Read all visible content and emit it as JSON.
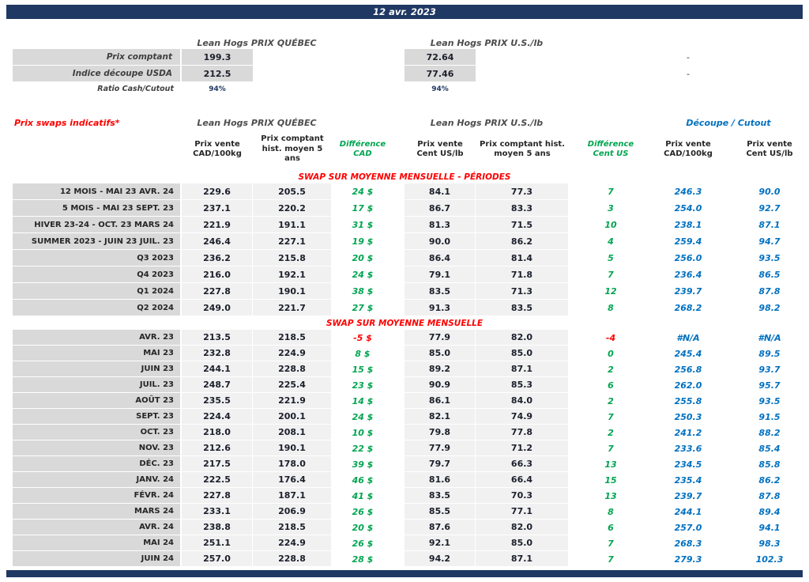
{
  "colors": {
    "navy": "#1F3864",
    "red": "#FF0000",
    "green": "#00A550",
    "blue": "#0070C0",
    "label_gray": "#D9D9D9",
    "cell_gray": "#F1F1F2"
  },
  "date_bar": {
    "date": "12 avr. 2023"
  },
  "spot": {
    "qc_title": "Lean Hogs PRIX QUÉBEC",
    "us_title": "Lean Hogs PRIX U.S./lb",
    "rows": [
      {
        "label": "Prix comptant",
        "qc": "199.3",
        "us": "72.64",
        "cutout": "-"
      },
      {
        "label": "Indice découpe USDA",
        "qc": "212.5",
        "us": "77.46",
        "cutout": "-"
      },
      {
        "label": "Ratio Cash/Cutout",
        "qc": "94%",
        "us": "94%",
        "cutout": ""
      }
    ]
  },
  "swaps": {
    "title": "Prix swaps indicatifs*",
    "qc_title": "Lean Hogs PRIX QUÉBEC",
    "us_title": "Lean Hogs PRIX U.S./lb",
    "cutout_title": "Découpe / Cutout",
    "columns": {
      "qc_sell": "Prix vente CAD/100kg",
      "qc_hist": "Prix comptant hist. moyen 5 ans",
      "diff_cad": "Différence CAD",
      "us_sell": "Prix vente Cent US/lb",
      "us_hist": "Prix comptant hist. moyen 5 ans",
      "diff_us": "Différence Cent US",
      "cut_cad": "Prix vente CAD/100kg",
      "cut_us": "Prix vente Cent US/lb"
    },
    "sections": [
      {
        "title": "SWAP SUR MOYENNE MENSUELLE - PÉRIODES",
        "rows": [
          {
            "label": "12 MOIS - MAI 23 AVR. 24",
            "qc_sell": "229.6",
            "qc_hist": "205.5",
            "diff_cad": "24 $",
            "us_sell": "84.1",
            "us_hist": "77.3",
            "diff_us": "7",
            "cut_cad": "246.3",
            "cut_us": "90.0"
          },
          {
            "label": "5 MOIS - MAI 23 SEPT. 23",
            "qc_sell": "237.1",
            "qc_hist": "220.2",
            "diff_cad": "17 $",
            "us_sell": "86.7",
            "us_hist": "83.3",
            "diff_us": "3",
            "cut_cad": "254.0",
            "cut_us": "92.7"
          },
          {
            "label": "HIVER 23-24 -  OCT. 23 MARS 24",
            "qc_sell": "221.9",
            "qc_hist": "191.1",
            "diff_cad": "31 $",
            "us_sell": "81.3",
            "us_hist": "71.5",
            "diff_us": "10",
            "cut_cad": "238.1",
            "cut_us": "87.1"
          },
          {
            "label": "SUMMER 2023 - JUIN 23 JUIL. 23",
            "qc_sell": "246.4",
            "qc_hist": "227.1",
            "diff_cad": "19 $",
            "us_sell": "90.0",
            "us_hist": "86.2",
            "diff_us": "4",
            "cut_cad": "259.4",
            "cut_us": "94.7"
          },
          {
            "label": "Q3 2023",
            "qc_sell": "236.2",
            "qc_hist": "215.8",
            "diff_cad": "20 $",
            "us_sell": "86.4",
            "us_hist": "81.4",
            "diff_us": "5",
            "cut_cad": "256.0",
            "cut_us": "93.5"
          },
          {
            "label": "Q4 2023",
            "qc_sell": "216.0",
            "qc_hist": "192.1",
            "diff_cad": "24 $",
            "us_sell": "79.1",
            "us_hist": "71.8",
            "diff_us": "7",
            "cut_cad": "236.4",
            "cut_us": "86.5"
          },
          {
            "label": "Q1 2024",
            "qc_sell": "227.8",
            "qc_hist": "190.1",
            "diff_cad": "38 $",
            "us_sell": "83.5",
            "us_hist": "71.3",
            "diff_us": "12",
            "cut_cad": "239.7",
            "cut_us": "87.8"
          },
          {
            "label": "Q2 2024",
            "qc_sell": "249.0",
            "qc_hist": "221.7",
            "diff_cad": "27 $",
            "us_sell": "91.3",
            "us_hist": "83.5",
            "diff_us": "8",
            "cut_cad": "268.2",
            "cut_us": "98.2"
          }
        ]
      },
      {
        "title": "SWAP SUR MOYENNE MENSUELLE",
        "rows": [
          {
            "label": "AVR. 23",
            "qc_sell": "213.5",
            "qc_hist": "218.5",
            "diff_cad": "-5 $",
            "us_sell": "77.9",
            "us_hist": "82.0",
            "diff_us": "-4",
            "cut_cad": "#N/A",
            "cut_us": "#N/A"
          },
          {
            "label": "MAI 23",
            "qc_sell": "232.8",
            "qc_hist": "224.9",
            "diff_cad": "8 $",
            "us_sell": "85.0",
            "us_hist": "85.0",
            "diff_us": "0",
            "cut_cad": "245.4",
            "cut_us": "89.5"
          },
          {
            "label": "JUIN 23",
            "qc_sell": "244.1",
            "qc_hist": "228.8",
            "diff_cad": "15 $",
            "us_sell": "89.2",
            "us_hist": "87.1",
            "diff_us": "2",
            "cut_cad": "256.8",
            "cut_us": "93.7"
          },
          {
            "label": "JUIL. 23",
            "qc_sell": "248.7",
            "qc_hist": "225.4",
            "diff_cad": "23 $",
            "us_sell": "90.9",
            "us_hist": "85.3",
            "diff_us": "6",
            "cut_cad": "262.0",
            "cut_us": "95.7"
          },
          {
            "label": "AOÛT 23",
            "qc_sell": "235.5",
            "qc_hist": "221.9",
            "diff_cad": "14 $",
            "us_sell": "86.1",
            "us_hist": "84.0",
            "diff_us": "2",
            "cut_cad": "255.8",
            "cut_us": "93.5"
          },
          {
            "label": "SEPT. 23",
            "qc_sell": "224.4",
            "qc_hist": "200.1",
            "diff_cad": "24 $",
            "us_sell": "82.1",
            "us_hist": "74.9",
            "diff_us": "7",
            "cut_cad": "250.3",
            "cut_us": "91.5"
          },
          {
            "label": "OCT. 23",
            "qc_sell": "218.0",
            "qc_hist": "208.1",
            "diff_cad": "10 $",
            "us_sell": "79.8",
            "us_hist": "77.8",
            "diff_us": "2",
            "cut_cad": "241.2",
            "cut_us": "88.2"
          },
          {
            "label": "NOV. 23",
            "qc_sell": "212.6",
            "qc_hist": "190.1",
            "diff_cad": "22 $",
            "us_sell": "77.9",
            "us_hist": "71.2",
            "diff_us": "7",
            "cut_cad": "233.6",
            "cut_us": "85.4"
          },
          {
            "label": "DÉC. 23",
            "qc_sell": "217.5",
            "qc_hist": "178.0",
            "diff_cad": "39 $",
            "us_sell": "79.7",
            "us_hist": "66.3",
            "diff_us": "13",
            "cut_cad": "234.5",
            "cut_us": "85.8"
          },
          {
            "label": "JANV. 24",
            "qc_sell": "222.5",
            "qc_hist": "176.4",
            "diff_cad": "46 $",
            "us_sell": "81.6",
            "us_hist": "66.4",
            "diff_us": "15",
            "cut_cad": "235.4",
            "cut_us": "86.2"
          },
          {
            "label": "FÉVR. 24",
            "qc_sell": "227.8",
            "qc_hist": "187.1",
            "diff_cad": "41 $",
            "us_sell": "83.5",
            "us_hist": "70.3",
            "diff_us": "13",
            "cut_cad": "239.7",
            "cut_us": "87.8"
          },
          {
            "label": "MARS 24",
            "qc_sell": "233.1",
            "qc_hist": "206.9",
            "diff_cad": "26 $",
            "us_sell": "85.5",
            "us_hist": "77.1",
            "diff_us": "8",
            "cut_cad": "244.1",
            "cut_us": "89.4"
          },
          {
            "label": "AVR. 24",
            "qc_sell": "238.8",
            "qc_hist": "218.5",
            "diff_cad": "20 $",
            "us_sell": "87.6",
            "us_hist": "82.0",
            "diff_us": "6",
            "cut_cad": "257.0",
            "cut_us": "94.1"
          },
          {
            "label": "MAI 24",
            "qc_sell": "251.1",
            "qc_hist": "224.9",
            "diff_cad": "26 $",
            "us_sell": "92.1",
            "us_hist": "85.0",
            "diff_us": "7",
            "cut_cad": "268.3",
            "cut_us": "98.3"
          },
          {
            "label": "JUIN 24",
            "qc_sell": "257.0",
            "qc_hist": "228.8",
            "diff_cad": "28 $",
            "us_sell": "94.2",
            "us_hist": "87.1",
            "diff_us": "7",
            "cut_cad": "279.3",
            "cut_us": "102.3"
          }
        ]
      }
    ]
  }
}
